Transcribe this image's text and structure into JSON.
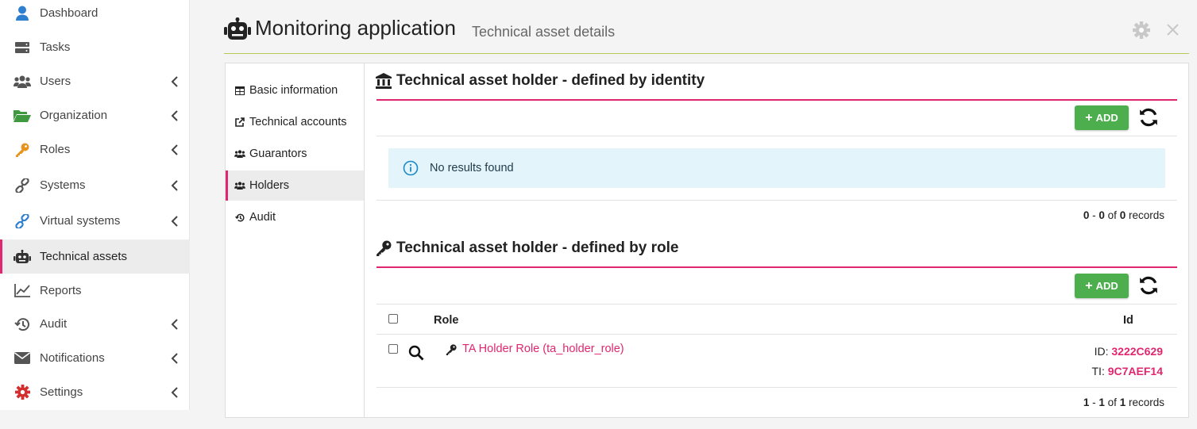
{
  "sidebar": {
    "items": [
      {
        "label": "Dashboard",
        "icon": "user-icon",
        "chevron": false,
        "active": false
      },
      {
        "label": "Tasks",
        "icon": "tasks-icon",
        "chevron": false,
        "active": false
      },
      {
        "label": "Users",
        "icon": "users-icon",
        "chevron": true,
        "active": false
      },
      {
        "label": "Organization",
        "icon": "folder-open-icon",
        "chevron": true,
        "active": false
      },
      {
        "label": "Roles",
        "icon": "key-icon",
        "chevron": true,
        "active": false
      },
      {
        "label": "Systems",
        "icon": "link-icon",
        "chevron": true,
        "active": false
      },
      {
        "label": "Virtual systems",
        "icon": "virtual-link-icon",
        "chevron": true,
        "active": false
      },
      {
        "label": "Technical assets",
        "icon": "robot-icon",
        "chevron": false,
        "active": true
      },
      {
        "label": "Reports",
        "icon": "line-chart-icon",
        "chevron": false,
        "active": false
      },
      {
        "label": "Audit",
        "icon": "history-icon",
        "chevron": true,
        "active": false
      },
      {
        "label": "Notifications",
        "icon": "envelope-icon",
        "chevron": true,
        "active": false
      },
      {
        "label": "Settings",
        "icon": "cog-icon",
        "chevron": true,
        "active": false
      }
    ]
  },
  "header": {
    "title": "Monitoring application",
    "subtitle": "Technical asset details"
  },
  "tabs": [
    {
      "label": "Basic information",
      "icon": "table-icon"
    },
    {
      "label": "Technical accounts",
      "icon": "external-link-icon"
    },
    {
      "label": "Guarantors",
      "icon": "users-icon"
    },
    {
      "label": "Holders",
      "icon": "users-icon",
      "active": true
    },
    {
      "label": "Audit",
      "icon": "history-icon"
    }
  ],
  "identity_section": {
    "title": "Technical asset holder - defined by identity",
    "add_label": "ADD",
    "alert": "No results found",
    "records": {
      "from": "0",
      "to": "0",
      "of_label": "of",
      "total": "0",
      "suffix": "records"
    }
  },
  "role_section": {
    "title": "Technical asset holder - defined by role",
    "add_label": "ADD",
    "columns": {
      "role": "Role",
      "id": "Id"
    },
    "rows": [
      {
        "role": "TA Holder Role (ta_holder_role)",
        "id_label": "ID:",
        "id_value": "3222C629",
        "ti_label": "TI:",
        "ti_value": "9C7AEF14"
      }
    ],
    "records": {
      "from": "1",
      "to": "1",
      "of_label": "of",
      "total": "1",
      "suffix": "records"
    }
  },
  "colors": {
    "accent": "#e0266e",
    "success": "#4cae4c",
    "info_bg": "#e3f4fb",
    "header_line": "#b7c957"
  }
}
